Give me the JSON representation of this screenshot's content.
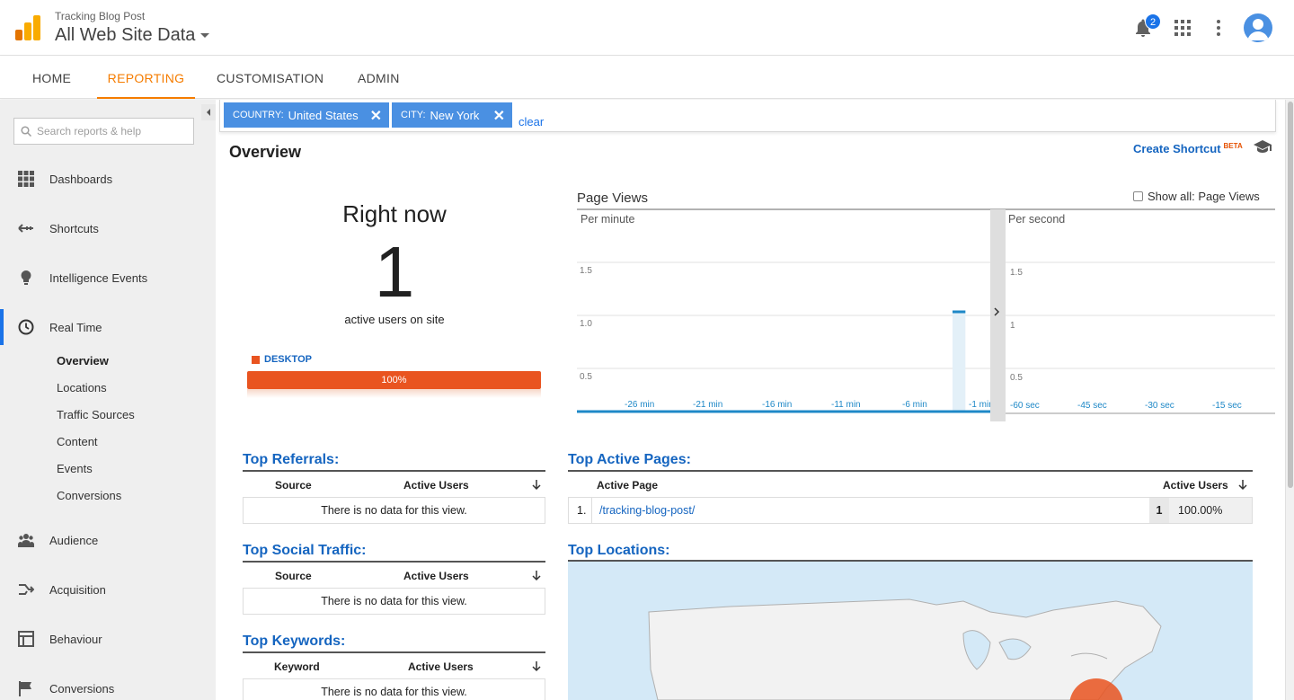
{
  "header": {
    "account_name": "Tracking Blog Post",
    "property_view": "All Web Site Data",
    "notification_count": "2"
  },
  "nav": {
    "tabs": [
      {
        "label": "HOME"
      },
      {
        "label": "REPORTING",
        "active": true
      },
      {
        "label": "CUSTOMISATION"
      },
      {
        "label": "ADMIN"
      }
    ]
  },
  "sidebar": {
    "search_placeholder": "Search reports & help",
    "items": [
      {
        "label": "Dashboards",
        "icon": "dashboards-grid-icon"
      },
      {
        "label": "Shortcuts",
        "icon": "shortcuts-arrow-icon"
      },
      {
        "label": "Intelligence Events",
        "icon": "lightbulb-icon"
      },
      {
        "label": "Real Time",
        "icon": "clock-icon",
        "active": true
      },
      {
        "label": "Audience",
        "icon": "people-icon"
      },
      {
        "label": "Acquisition",
        "icon": "acquisition-arrows-icon"
      },
      {
        "label": "Behaviour",
        "icon": "behaviour-layout-icon"
      },
      {
        "label": "Conversions",
        "icon": "flag-icon"
      }
    ],
    "realtime_sub": [
      "Overview",
      "Locations",
      "Traffic Sources",
      "Content",
      "Events",
      "Conversions"
    ]
  },
  "filters": {
    "chips": [
      {
        "key": "COUNTRY:",
        "value": "United States"
      },
      {
        "key": "CITY:",
        "value": "New York"
      }
    ],
    "clear_label": "clear"
  },
  "overview": {
    "title": "Overview",
    "create_shortcut": "Create Shortcut",
    "beta": "BETA",
    "right_now_label": "Right now",
    "active_users": "1",
    "active_users_text": "active users on site",
    "device_label": "DESKTOP",
    "device_share": 1.0,
    "device_share_label": "100%"
  },
  "pageviews": {
    "title": "Page Views",
    "show_all_label": "Show all: Page Views",
    "per_minute_label": "Per minute",
    "per_second_label": "Per second",
    "minute_yticks": [
      "1.5",
      "1.0",
      "0.5"
    ],
    "second_yticks": [
      "1.5",
      "1",
      "0.5"
    ],
    "minute_xticks": [
      "-26 min",
      "-21 min",
      "-16 min",
      "-11 min",
      "-6 min",
      "-1 min"
    ],
    "second_xticks": [
      "-60 sec",
      "-45 sec",
      "-30 sec",
      "-15 sec"
    ]
  },
  "chart_data": {
    "type": "bar",
    "title": "Page Views",
    "ylim": [
      0,
      2
    ],
    "series": [
      {
        "name": "Per minute",
        "x_minutes_ago": [
          2
        ],
        "values": [
          1.0
        ]
      },
      {
        "name": "Per second",
        "values": []
      }
    ],
    "legend_position": "none"
  },
  "referrals": {
    "title": "Top Referrals:",
    "col_source": "Source",
    "col_active": "Active Users",
    "empty": "There is no data for this view."
  },
  "social": {
    "title": "Top Social Traffic:",
    "col_source": "Source",
    "col_active": "Active Users",
    "empty": "There is no data for this view."
  },
  "keywords": {
    "title": "Top Keywords:",
    "col_keyword": "Keyword",
    "col_active": "Active Users",
    "empty": "There is no data for this view."
  },
  "pages": {
    "title": "Top Active Pages:",
    "col_page": "Active Page",
    "col_active": "Active Users",
    "rows": [
      {
        "rank": "1.",
        "page": "/tracking-blog-post/",
        "users": "1",
        "pct": "100.00%"
      }
    ]
  },
  "locations": {
    "title": "Top Locations:"
  },
  "colors": {
    "accent_orange": "#f57c00",
    "link_blue": "#1565c0",
    "chip_blue": "#4a90e2",
    "device_orange": "#e95420"
  }
}
